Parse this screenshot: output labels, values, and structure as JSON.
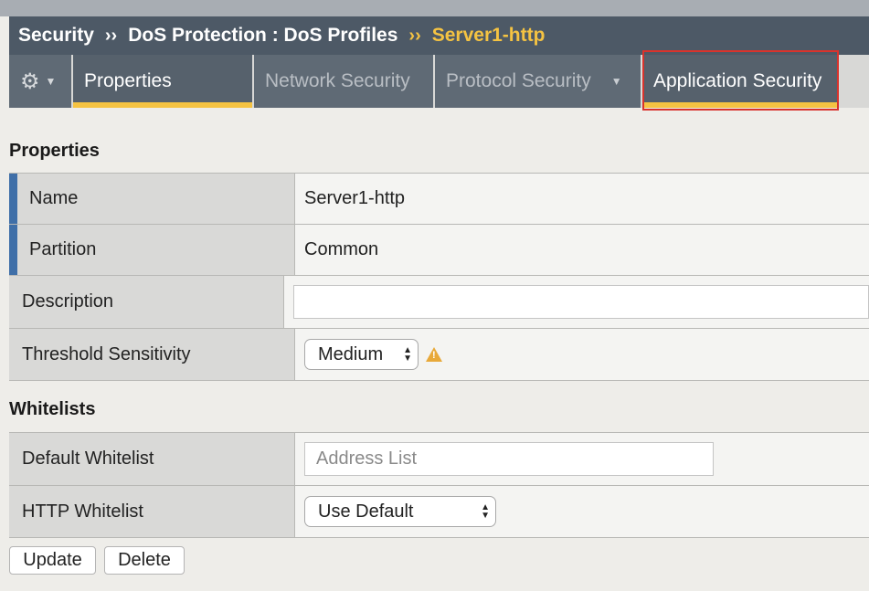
{
  "breadcrumb": {
    "items": [
      "Security",
      "DoS Protection : DoS Profiles"
    ],
    "separator": "››",
    "current": "Server1-http"
  },
  "tabs": {
    "gear_icon": "gear-icon",
    "items": [
      {
        "label": "Properties",
        "state": "active"
      },
      {
        "label": "Network Security",
        "state": "inactive"
      },
      {
        "label": "Protocol Security",
        "state": "inactive",
        "has_dropdown": true
      },
      {
        "label": "Application Security",
        "state": "highlighted"
      }
    ]
  },
  "properties": {
    "title": "Properties",
    "name_label": "Name",
    "name_value": "Server1-http",
    "partition_label": "Partition",
    "partition_value": "Common",
    "description_label": "Description",
    "description_value": "",
    "threshold_label": "Threshold Sensitivity",
    "threshold_value": "Medium",
    "warning_icon": "warning-icon"
  },
  "whitelists": {
    "title": "Whitelists",
    "default_label": "Default Whitelist",
    "default_placeholder": "Address List",
    "http_label": "HTTP Whitelist",
    "http_value": "Use Default"
  },
  "actions": {
    "update_label": "Update",
    "delete_label": "Delete"
  },
  "colors": {
    "accent": "#f5c342",
    "header_bg": "#4d5966",
    "tab_bg": "#5f6a75",
    "required_marker": "#3f6fa8",
    "highlight_box": "#d9332c",
    "warning": "#e8a93a"
  }
}
